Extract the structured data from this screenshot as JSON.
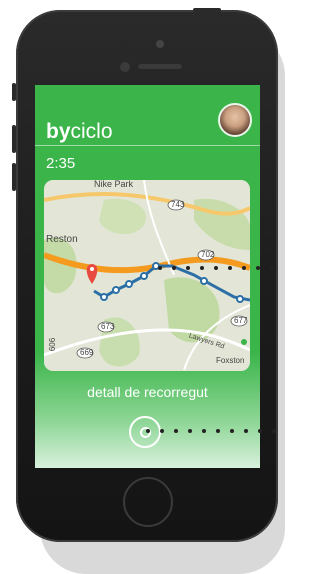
{
  "app": {
    "logo_bold": "by",
    "logo_light": "ciclo"
  },
  "header": {
    "time": "2:35"
  },
  "map": {
    "labels": {
      "nike_park": "Nike Park",
      "reston": "Reston",
      "foxstone": "Foxston",
      "lawyers_rd": "Lawyers Rd",
      "r743": "743",
      "r702": "702",
      "r673": "673",
      "r669": "669",
      "r606": "606",
      "r677": "677"
    }
  },
  "detail": {
    "caption": "detall de recorregut"
  },
  "colors": {
    "brand_green": "#3bb54a",
    "route_blue": "#2b6fa6",
    "toll_orange": "#f39a1f"
  }
}
